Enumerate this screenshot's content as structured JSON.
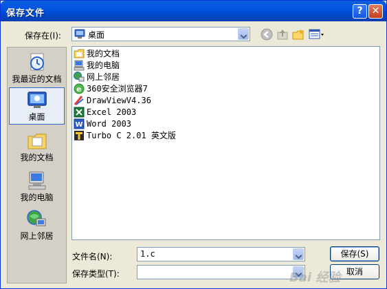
{
  "window": {
    "title": "保存文件"
  },
  "titlebar": {
    "help_label": "?",
    "close_label": "✕"
  },
  "savein": {
    "label": "保存在(I):",
    "value": "桌面",
    "icon": "desktop-icon"
  },
  "places": [
    {
      "label": "我最近的文档",
      "icon": "recent-documents-icon"
    },
    {
      "label": "桌面",
      "icon": "desktop-icon"
    },
    {
      "label": "我的文档",
      "icon": "my-documents-folder-icon"
    },
    {
      "label": "我的电脑",
      "icon": "my-computer-icon"
    },
    {
      "label": "网上邻居",
      "icon": "network-places-icon"
    }
  ],
  "files": [
    {
      "name": "我的文档",
      "icon": "folder-icon"
    },
    {
      "name": "我的电脑",
      "icon": "computer-icon"
    },
    {
      "name": "网上邻居",
      "icon": "network-icon"
    },
    {
      "name": "360安全浏览器7",
      "icon": "browser-icon"
    },
    {
      "name": "DrawViewV4.36",
      "icon": "drawview-icon"
    },
    {
      "name": "Excel 2003",
      "icon": "excel-icon"
    },
    {
      "name": "Word 2003",
      "icon": "word-icon"
    },
    {
      "name": "Turbo C 2.01 英文版",
      "icon": "turbo-c-icon"
    }
  ],
  "filename": {
    "label": "文件名(N):",
    "value": "1.c"
  },
  "filetype": {
    "label": "保存类型(T):",
    "value": ""
  },
  "buttons": {
    "save": "保存(S)",
    "cancel": "取消"
  },
  "watermark": "Bai 经验"
}
